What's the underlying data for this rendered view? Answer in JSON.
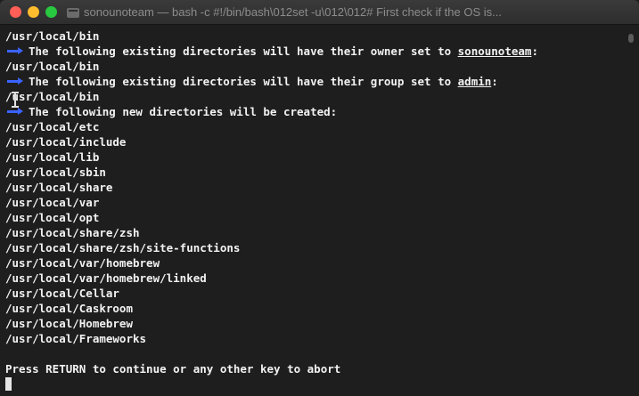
{
  "window": {
    "title": "sonounoteam — bash -c #!/bin/bash\\012set -u\\012\\012# First check if the OS is..."
  },
  "terminal": {
    "lines": [
      "/usr/local/bin",
      "The following existing directories will have their owner set to ",
      "sonounoteam",
      ":",
      "/usr/local/bin",
      "The following existing directories will have their group set to ",
      "admin",
      ":",
      "/usr/local/bin",
      "The following new directories will be created:",
      "/usr/local/etc",
      "/usr/local/include",
      "/usr/local/lib",
      "/usr/local/sbin",
      "/usr/local/share",
      "/usr/local/var",
      "/usr/local/opt",
      "/usr/local/share/zsh",
      "/usr/local/share/zsh/site-functions",
      "/usr/local/var/homebrew",
      "/usr/local/var/homebrew/linked",
      "/usr/local/Cellar",
      "/usr/local/Caskroom",
      "/usr/local/Homebrew",
      "/usr/local/Frameworks",
      "",
      "Press RETURN to continue or any other key to abort"
    ]
  },
  "colors": {
    "arrow": "#3b63ff",
    "text": "#f2f2f2",
    "background": "#1e1e1e"
  }
}
